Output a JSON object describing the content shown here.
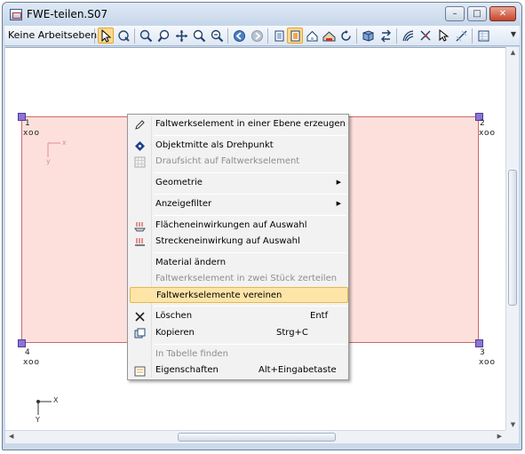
{
  "window": {
    "title": "FWE-teilen.S07",
    "controls": {
      "minimize": "–",
      "maximize": "□",
      "close": "✕"
    }
  },
  "toolbar": {
    "workplane_dropdown": "Keine Arbeitseben",
    "icons": [
      "select-arrow-icon",
      "rotate-select-icon",
      "zoom-window-icon",
      "zoom-icon",
      "pan-icon",
      "zoom-in-icon",
      "zoom-out-icon",
      "back-icon",
      "forward-icon",
      "view-top-icon",
      "view-plane-icon",
      "house-icon",
      "house-render-icon",
      "rotate-icon",
      "cube-view-icon",
      "swap-icon",
      "wave-icon",
      "node-select-icon",
      "grid-icon",
      "table-icon"
    ]
  },
  "canvas": {
    "nodes": [
      {
        "id": "1",
        "sub": "xoo"
      },
      {
        "id": "2",
        "sub": "xoo"
      },
      {
        "id": "3",
        "sub": "xoo"
      },
      {
        "id": "4",
        "sub": "xoo"
      }
    ],
    "local_axes": {
      "x": "x",
      "y": "y"
    },
    "global_axes": {
      "x": "X",
      "y": "Y"
    }
  },
  "context_menu": {
    "items": [
      {
        "label": "Faltwerkselement in einer Ebene erzeugen",
        "icon": "pencil-plane-icon",
        "disabled": false
      },
      {
        "label": "Objektmitte als Drehpunkt",
        "icon": "center-point-icon",
        "disabled": false
      },
      {
        "label": "Draufsicht auf Faltwerkselement",
        "icon": "grid-view-icon",
        "disabled": true
      },
      {
        "label": "Geometrie",
        "submenu": true
      },
      {
        "label": "Anzeigefilter",
        "submenu": true
      },
      {
        "label": "Flächeneinwirkungen auf Auswahl",
        "icon": "area-load-icon"
      },
      {
        "label": "Streckeneinwirkung auf Auswahl",
        "icon": "line-load-icon"
      },
      {
        "label": "Material ändern"
      },
      {
        "label": "Faltwerkselement in zwei Stück zerteilen",
        "disabled": true
      },
      {
        "label": "Faltwerkselemente vereinen",
        "highlighted": true
      },
      {
        "label": "Löschen",
        "shortcut": "Entf",
        "icon": "delete-x-icon"
      },
      {
        "label": "Kopieren",
        "shortcut": "Strg+C",
        "icon": "copy-icon"
      },
      {
        "label": "In Tabelle finden",
        "disabled": true
      },
      {
        "label": "Eigenschaften",
        "shortcut": "Alt+Eingabetaste",
        "icon": "properties-icon"
      }
    ]
  }
}
